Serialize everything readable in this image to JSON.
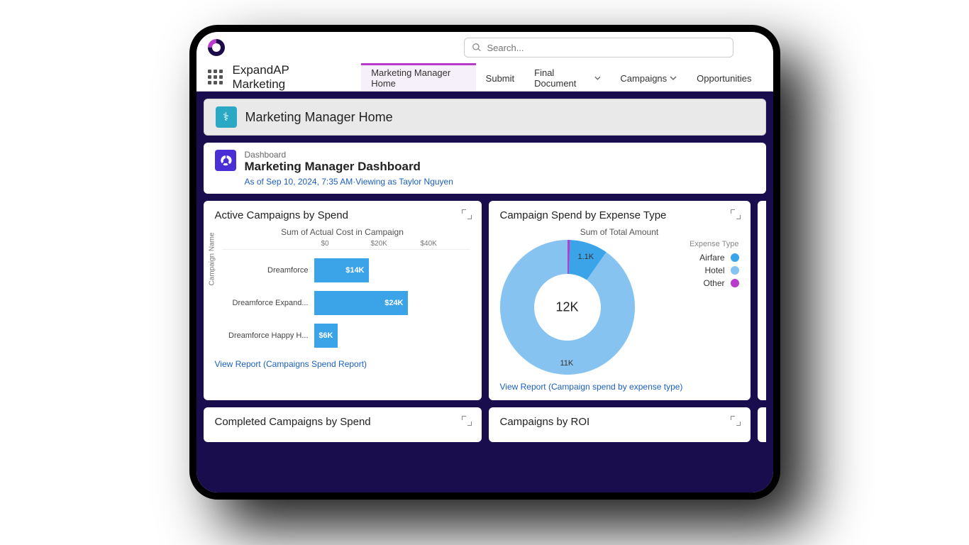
{
  "search": {
    "placeholder": "Search..."
  },
  "app_name": "ExpandAP Marketing",
  "nav": {
    "home": "Marketing Manager Home",
    "submit": "Submit",
    "final": "Final Document",
    "campaigns": "Campaigns",
    "opportunities": "Opportunities"
  },
  "page_header": "Marketing Manager Home",
  "dashboard": {
    "label": "Dashboard",
    "title": "Marketing Manager Dashboard",
    "meta": "As of Sep 10, 2024, 7:35 AM·Viewing as Taylor Nguyen"
  },
  "panel1": {
    "title": "Active Campaigns by Spend",
    "subtitle": "Sum of Actual Cost in Campaign",
    "ylabel": "Campaign Name",
    "ticks": {
      "t0": "$0",
      "t1": "$20K",
      "t2": "$40K"
    },
    "rows": [
      {
        "label": "Dreamforce",
        "value": "$14K",
        "width": "35%"
      },
      {
        "label": "Dreamforce Expand...",
        "value": "$24K",
        "width": "60%"
      },
      {
        "label": "Dreamforce Happy H...",
        "value": "$6K",
        "width": "15%"
      }
    ],
    "link": "View Report (Campaigns Spend Report)"
  },
  "panel2": {
    "title": "Campaign Spend by Expense Type",
    "subtitle": "Sum of Total Amount",
    "center": "12K",
    "seg1": "1.1K",
    "seg2": "11K",
    "legend_title": "Expense Type",
    "legend": [
      {
        "label": "Airfare",
        "color": "#3ba4e8"
      },
      {
        "label": "Hotel",
        "color": "#86c3f0"
      },
      {
        "label": "Other",
        "color": "#b83cc9"
      }
    ],
    "link": "View Report (Campaign spend by expense type)"
  },
  "panel3": {
    "title": "Completed Campaigns by Spend"
  },
  "panel4": {
    "title": "Campaigns by ROI"
  },
  "chart_data": [
    {
      "type": "bar",
      "title": "Active Campaigns by Spend",
      "subtitle": "Sum of Actual Cost in Campaign",
      "xlabel": "Sum of Actual Cost in Campaign",
      "ylabel": "Campaign Name",
      "orientation": "horizontal",
      "xlim": [
        0,
        40000
      ],
      "xticks": [
        0,
        20000,
        40000
      ],
      "categories": [
        "Dreamforce",
        "Dreamforce Expand...",
        "Dreamforce Happy H..."
      ],
      "values": [
        14000,
        24000,
        6000
      ],
      "unit": "USD"
    },
    {
      "type": "donut",
      "title": "Campaign Spend by Expense Type",
      "subtitle": "Sum of Total Amount",
      "center_label": "12K",
      "total": 12000,
      "series": [
        {
          "name": "Airfare",
          "value": 1100,
          "color": "#3ba4e8"
        },
        {
          "name": "Hotel",
          "value": 11000,
          "color": "#86c3f0"
        },
        {
          "name": "Other",
          "value": 100,
          "color": "#b83cc9"
        }
      ]
    }
  ]
}
